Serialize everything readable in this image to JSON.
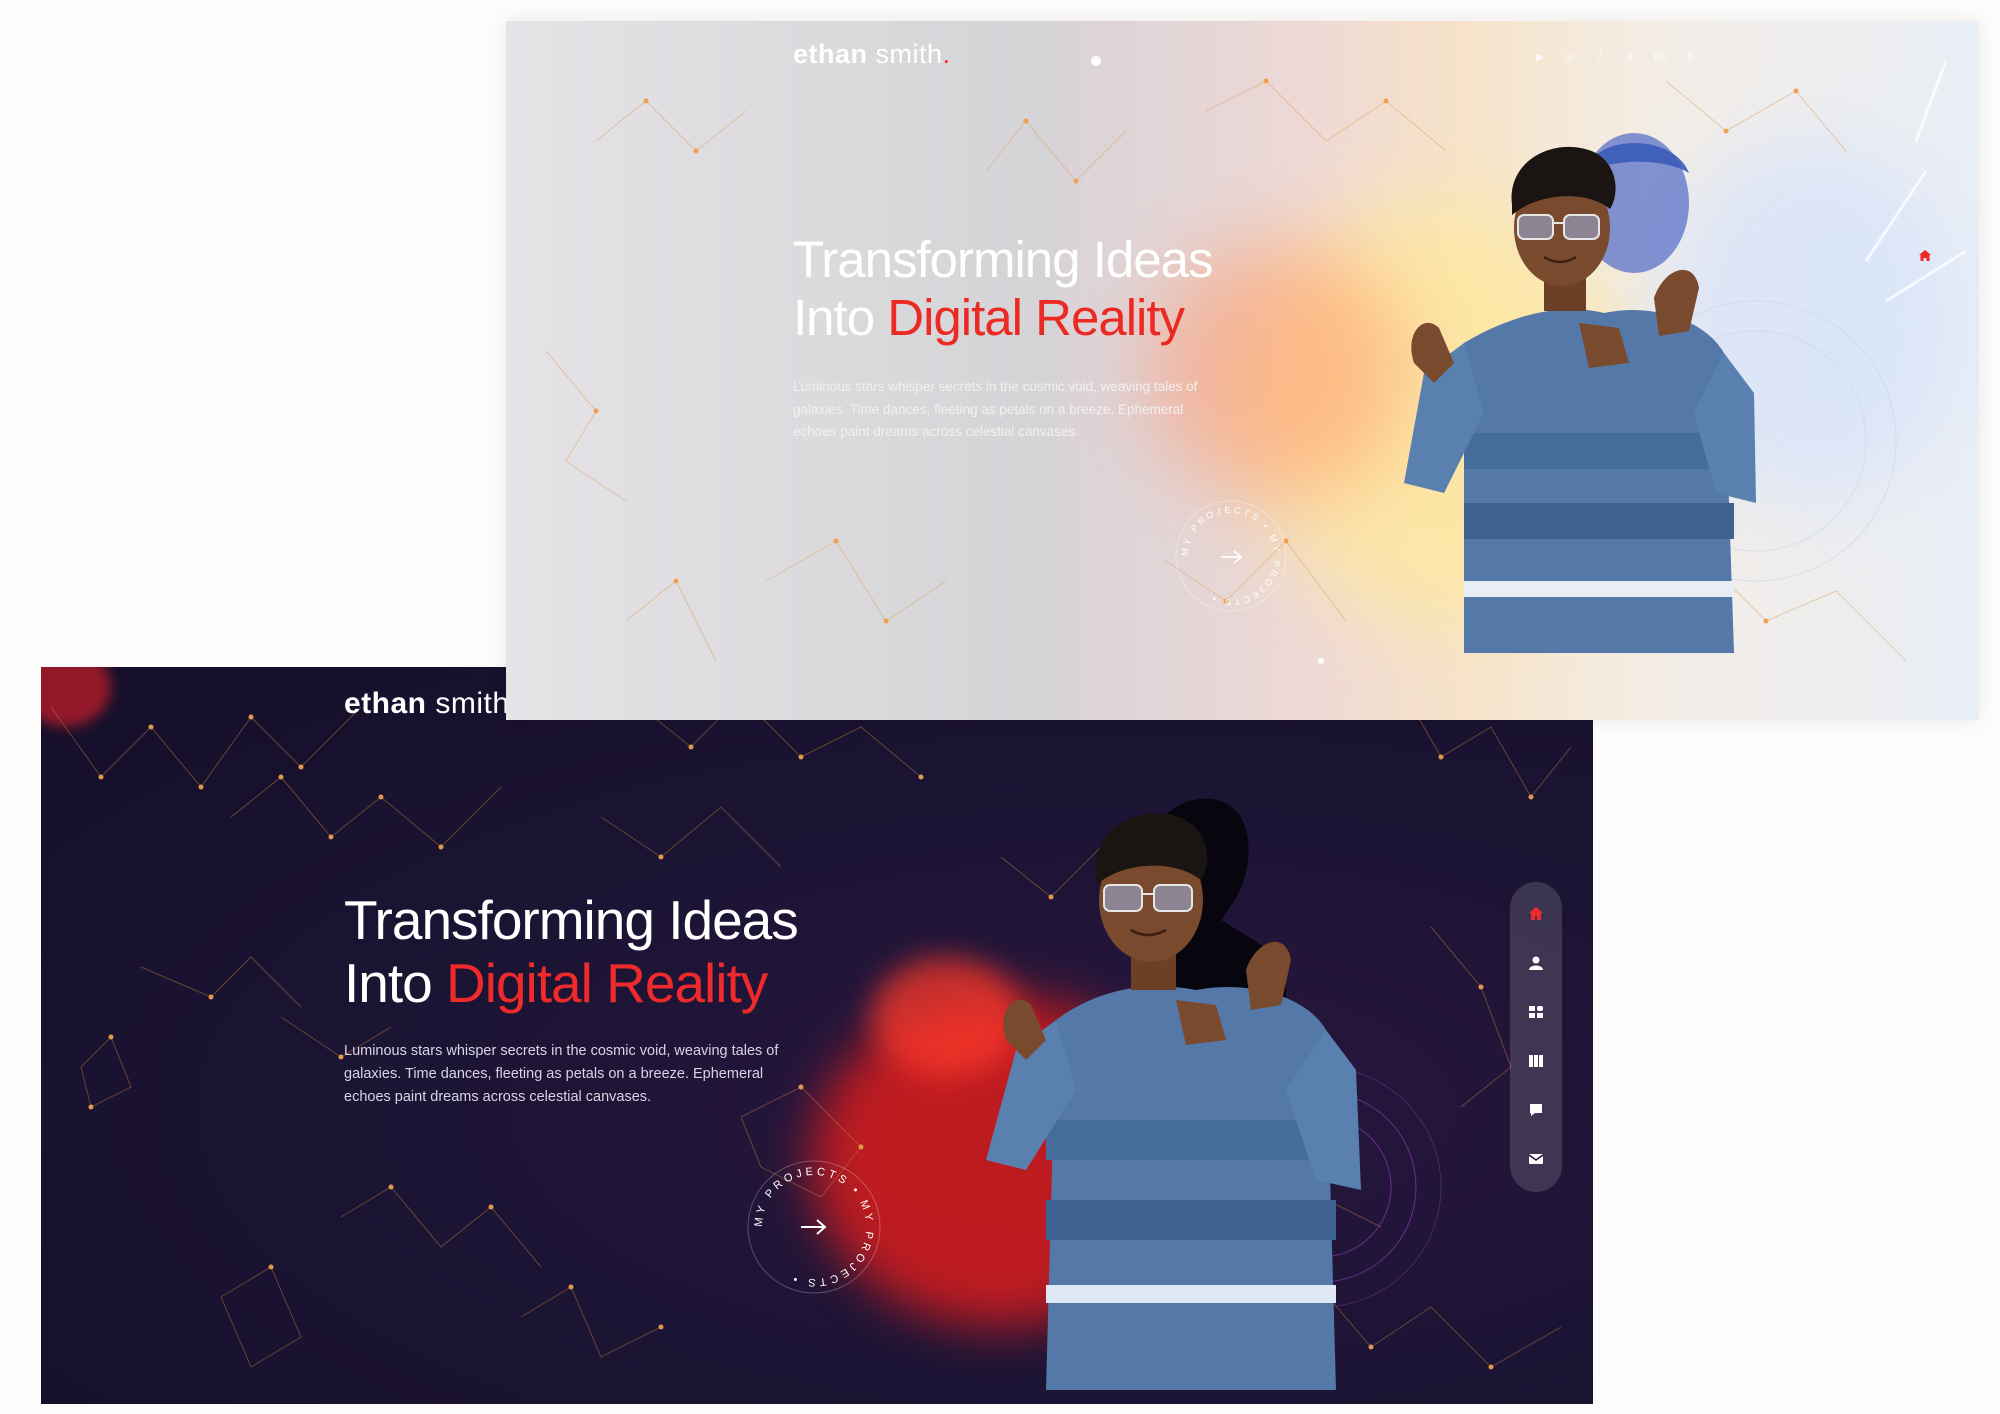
{
  "dark_screen": {
    "logo": {
      "bold": "ethan",
      "light": "smith"
    },
    "hero": {
      "line1": "Transforming Ideas",
      "line2_plain": "Into",
      "line2_accent": "Digital Reality",
      "description": "Luminous stars whisper secrets in the cosmic void, weaving tales of galaxies. Time dances, fleeting as petals on a breeze. Ephemeral echoes paint dreams across celestial canvases."
    },
    "cta": {
      "ring_text": "MY PROJECTS • MY PROJECTS • ",
      "icon": "arrow-right-icon"
    },
    "side_nav": [
      {
        "name": "home",
        "icon": "home-icon",
        "active": true
      },
      {
        "name": "about",
        "icon": "user-icon",
        "active": false
      },
      {
        "name": "services",
        "icon": "grid-icon",
        "active": false
      },
      {
        "name": "portfolio",
        "icon": "columns-icon",
        "active": false
      },
      {
        "name": "testimonials",
        "icon": "chat-icon",
        "active": false
      },
      {
        "name": "contact",
        "icon": "mail-icon",
        "active": false
      }
    ]
  },
  "light_screen": {
    "logo": {
      "bold": "ethan",
      "light": "smith",
      "dot": "."
    },
    "socials": [
      {
        "name": "youtube",
        "icon": "youtube-icon",
        "glyph": "▶"
      },
      {
        "name": "instagram",
        "icon": "instagram-icon",
        "glyph": "◎"
      },
      {
        "name": "facebook",
        "icon": "facebook-icon",
        "glyph": "f"
      },
      {
        "name": "dribbble",
        "icon": "dribbble-icon",
        "glyph": "⊛"
      },
      {
        "name": "behance",
        "icon": "behance-icon",
        "glyph": "Bē"
      },
      {
        "name": "pinterest",
        "icon": "pinterest-icon",
        "glyph": "℗"
      }
    ],
    "hero": {
      "line1": "Transforming Ideas",
      "line2_plain": "Into",
      "line2_accent": "Digital Reality",
      "description": "Luminous stars whisper secrets in the cosmic void, weaving tales of galaxies. Time dances, fleeting as petals on a breeze. Ephemeral echoes paint dreams across celestial canvases."
    },
    "cta": {
      "ring_text": "MY PROJECTS • MY PROJECTS • ",
      "icon": "arrow-right-icon"
    }
  },
  "colors": {
    "accent": "#ef2a2a",
    "dark_bg": "#1c1434",
    "node_orange": "#d9893a",
    "sweater_blue": "#5479a8",
    "sweater_light": "#8ca6c8",
    "skin": "#7a4a2e",
    "hair": "#1a1412"
  }
}
